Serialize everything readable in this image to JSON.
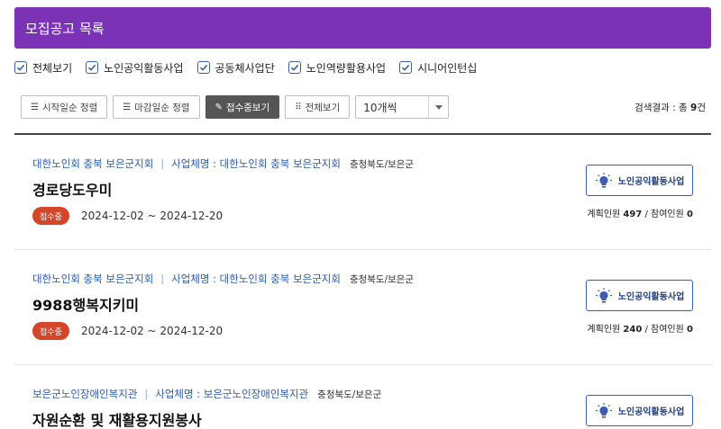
{
  "header": {
    "title": "모집공고 목록"
  },
  "filters": [
    {
      "label": "전체보기",
      "checked": true
    },
    {
      "label": "노인공익활동사업",
      "checked": true
    },
    {
      "label": "공동체사업단",
      "checked": true
    },
    {
      "label": "노인역량활용사업",
      "checked": true
    },
    {
      "label": "시니어인턴십",
      "checked": true
    }
  ],
  "toolbar": {
    "sort_start": "시작일순 정렬",
    "sort_end": "마감일순 정렬",
    "view_open": "접수중보기",
    "view_all": "전체보기",
    "page_size": "10개씩"
  },
  "result": {
    "prefix": "검색결과 : 총 ",
    "count": "9",
    "suffix": "건"
  },
  "colors": {
    "header": "#7b32b4",
    "accent": "#3a5fb0",
    "badge": "#d4452a"
  },
  "list": [
    {
      "org": "대한노인회 충북 보은군지회",
      "biz": "사업체명 : 대한노인회 충북 보은군지회",
      "region": "충청북도/보은군",
      "title": "경로당도우미",
      "status": "접수중",
      "period": "2024-12-02 ~ 2024-12-20",
      "type": "노인공익활동사업",
      "planned_label": "계획인원",
      "planned": "497",
      "joined_label": "참여인원",
      "joined": "0"
    },
    {
      "org": "대한노인회 충북 보은군지회",
      "biz": "사업체명 : 대한노인회 충북 보은군지회",
      "region": "충청북도/보은군",
      "title": "9988행복지키미",
      "status": "접수중",
      "period": "2024-12-02 ~ 2024-12-20",
      "type": "노인공익활동사업",
      "planned_label": "계획인원",
      "planned": "240",
      "joined_label": "참여인원",
      "joined": "0"
    },
    {
      "org": "보은군노인장애인복지관",
      "biz": "사업체명 : 보은군노인장애인복지관",
      "region": "충청북도/보은군",
      "title": "자원순환 및 재활용지원봉사",
      "type": "노인공익활동사업"
    }
  ]
}
